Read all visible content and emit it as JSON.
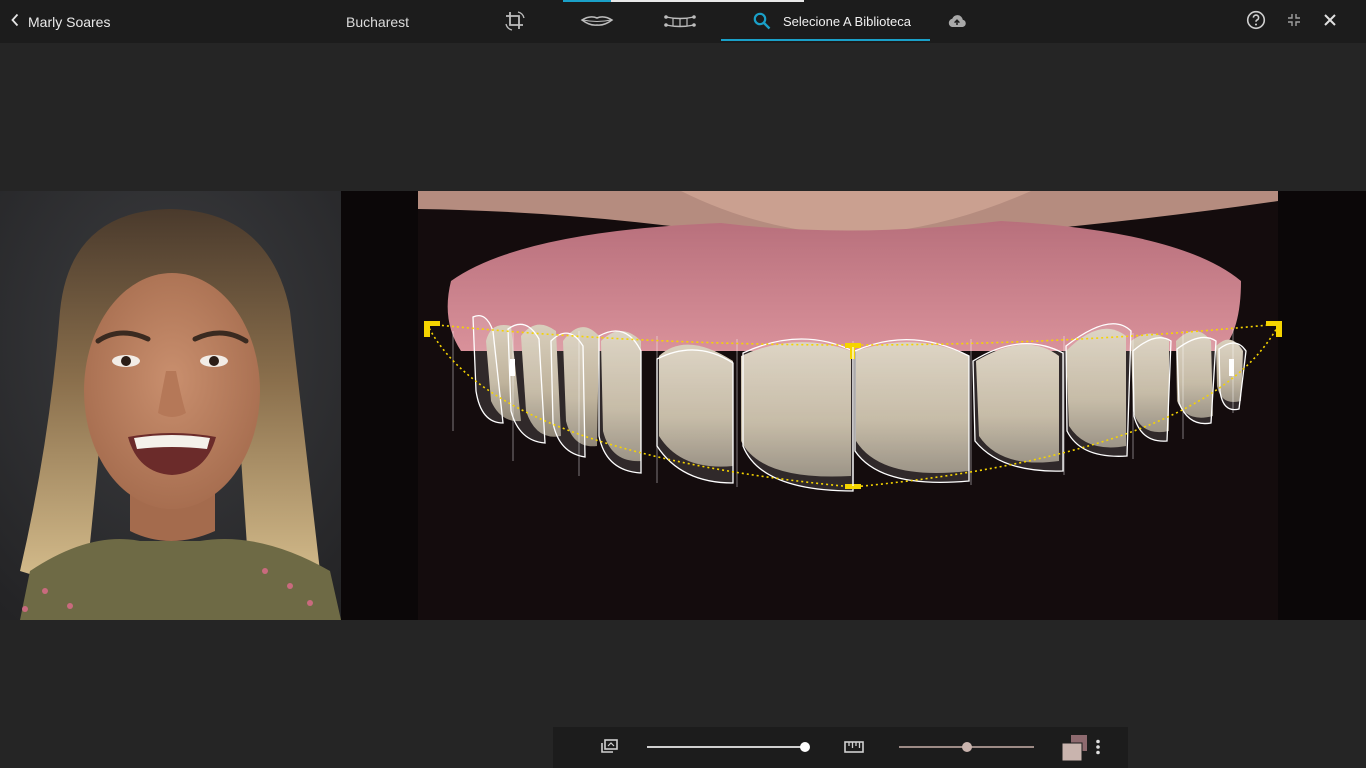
{
  "header": {
    "back_label": "Marly Soares",
    "city": "Bucharest",
    "library_label": "Selecione A Biblioteca",
    "progress": 0.2,
    "tools": [
      "crop-rotate-icon",
      "lip-outline-icon",
      "teeth-grid-icon",
      "search-icon",
      "cloud-upload-icon"
    ],
    "right_icons": [
      "help-icon",
      "fullscreen-exit-icon",
      "close-icon"
    ]
  },
  "images": {
    "portrait": "patient-face-photo",
    "smile": "smile-closeup-photo-with-tooth-library-overlay"
  },
  "bottom_toolbar": {
    "layers_icon": "layers-icon",
    "opacity_slider_value": 1.0,
    "ruler_icon": "ruler-icon",
    "size_slider_value": 0.5,
    "color_swatch_icon": "color-swatch-icon",
    "more_icon": "more-vertical-icon"
  },
  "colors": {
    "accent": "#1aa0c8",
    "guide_yellow": "#f5d400",
    "bar_bg": "#1c1c1c",
    "canvas_bg": "#252525",
    "swatch": "#c9b4ae"
  }
}
